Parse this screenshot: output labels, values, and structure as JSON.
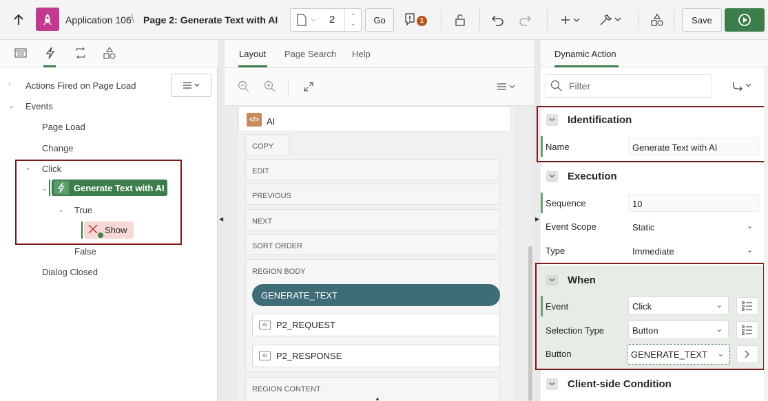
{
  "toolbar": {
    "app_name": "Application 106",
    "separator": "\\",
    "page_title": "Page 2: Generate Text with AI",
    "page_number": "2",
    "go_label": "Go",
    "warnings_count": "1",
    "save_label": "Save"
  },
  "left_tree": {
    "actions_fired": "Actions Fired on Page Load",
    "events": "Events",
    "page_load": "Page Load",
    "change": "Change",
    "click": "Click",
    "dynamic_action": "Generate Text with AI",
    "true_branch": "True",
    "show_action": "Show",
    "false_branch": "False",
    "dialog_closed": "Dialog Closed"
  },
  "middle": {
    "tabs": [
      "Layout",
      "Page Search",
      "Help"
    ],
    "region_title": "AI",
    "region_icon_text": "</>",
    "positions": [
      "COPY",
      "EDIT",
      "PREVIOUS",
      "NEXT",
      "SORT ORDER",
      "REGION BODY",
      "REGION CONTENT"
    ],
    "button_label": "GENERATE_TEXT",
    "item_tag": "AI",
    "items": [
      "P2_REQUEST",
      "P2_RESPONSE"
    ]
  },
  "right": {
    "tab": "Dynamic Action",
    "filter_placeholder": "Filter",
    "identification": {
      "title": "Identification",
      "name_label": "Name",
      "name_value": "Generate Text with AI"
    },
    "execution": {
      "title": "Execution",
      "sequence_label": "Sequence",
      "sequence_value": "10",
      "scope_label": "Event Scope",
      "scope_value": "Static",
      "type_label": "Type",
      "type_value": "Immediate"
    },
    "when": {
      "title": "When",
      "event_label": "Event",
      "event_value": "Click",
      "selection_label": "Selection Type",
      "selection_value": "Button",
      "button_label": "Button",
      "button_value": "GENERATE_TEXT"
    },
    "client_condition": {
      "title": "Client-side Condition"
    }
  },
  "colors": {
    "accent_green": "#3c7d4c",
    "app_icon": "#c23a8f",
    "highlight_box": "#7a1a1a",
    "button_pill": "#3f6d77"
  }
}
